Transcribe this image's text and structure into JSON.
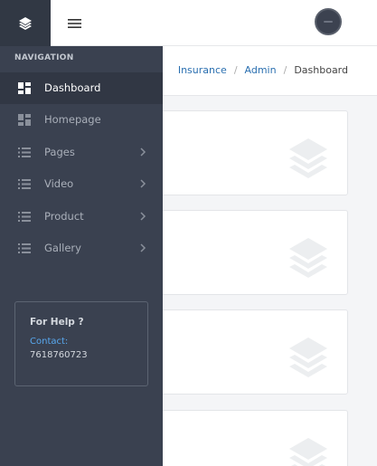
{
  "topbar": {
    "logo_icon": "layers-icon",
    "menu_icon": "hamburger-icon",
    "avatar_icon": "user-avatar"
  },
  "breadcrumb": {
    "items": [
      "Insurance",
      "Admin",
      "Dashboard"
    ],
    "separator": "/"
  },
  "sidebar": {
    "heading": "NAVIGATION",
    "items": [
      {
        "label": "Dashboard",
        "icon": "dashboard-icon",
        "active": true,
        "has_submenu": false
      },
      {
        "label": "Homepage",
        "icon": "dashboard-icon",
        "active": false,
        "has_submenu": false
      },
      {
        "label": "Pages",
        "icon": "list-icon",
        "active": false,
        "has_submenu": true
      },
      {
        "label": "Video",
        "icon": "list-icon",
        "active": false,
        "has_submenu": true
      },
      {
        "label": "Product",
        "icon": "list-icon",
        "active": false,
        "has_submenu": true
      },
      {
        "label": "Gallery",
        "icon": "list-icon",
        "active": false,
        "has_submenu": true
      }
    ],
    "help": {
      "title": "For Help ?",
      "contact_label": "Contact:",
      "phone": "7618760723"
    }
  },
  "cards": [
    {
      "icon": "layers-icon"
    },
    {
      "icon": "layers-icon"
    },
    {
      "icon": "layers-icon"
    },
    {
      "icon": "layers-icon"
    }
  ],
  "colors": {
    "sidebar_bg": "#3a4150",
    "sidebar_active_bg": "#313744",
    "logo_bg": "#313844",
    "link": "#2a6fb0",
    "help_contact": "#58a8ef"
  }
}
